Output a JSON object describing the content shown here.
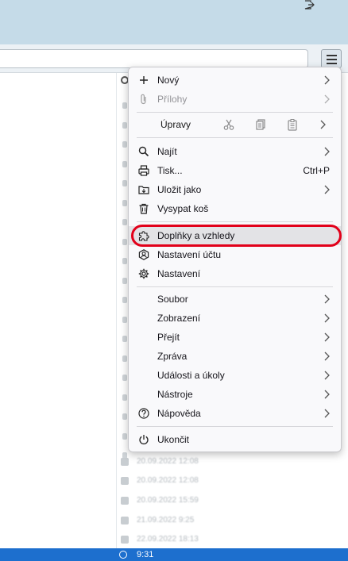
{
  "menu": {
    "new_label": "Nový",
    "attachments_label": "Přílohy",
    "edit_label": "Úpravy",
    "find_label": "Najít",
    "print_label": "Tisk...",
    "print_shortcut": "Ctrl+P",
    "save_as_label": "Uložit jako",
    "empty_trash_label": "Vysypat koš",
    "addons_label": "Doplňky a vzhledy",
    "account_settings_label": "Nastavení účtu",
    "settings_label": "Nastavení",
    "file_label": "Soubor",
    "view_label": "Zobrazení",
    "go_label": "Přejít",
    "message_label": "Zpráva",
    "events_tasks_label": "Události a úkoly",
    "tools_label": "Nástroje",
    "help_label": "Nápověda",
    "quit_label": "Ukončit"
  },
  "message_list": {
    "dates": [
      "20.09.2022 12:08",
      "20.09.2022 12:08",
      "20.09.2022 15:59",
      "21.09.2022 9:25",
      "22.09.2022 18:13"
    ],
    "selected_time": "9:31"
  },
  "colors": {
    "highlight_ring": "#e2001a",
    "selection": "#1d6fce",
    "top_bar": "#c5dbe8"
  },
  "icons": [
    "exit-icon",
    "hamburger-icon",
    "plus-icon",
    "paperclip-icon",
    "scissors-icon",
    "copy-icon",
    "paste-icon",
    "search-icon",
    "printer-icon",
    "save-icon",
    "trash-icon",
    "puzzle-icon",
    "account-icon",
    "gear-icon",
    "help-icon",
    "power-icon",
    "chevron-right-icon"
  ]
}
